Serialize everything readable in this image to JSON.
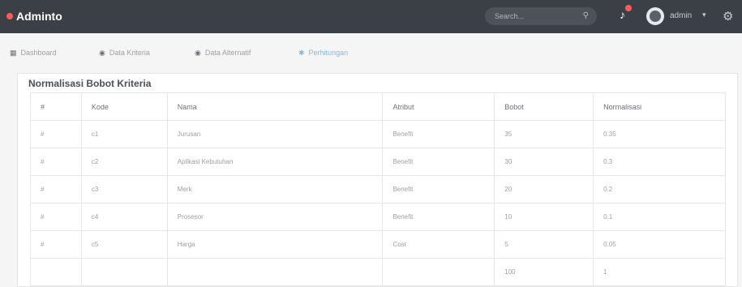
{
  "brand": {
    "name": "Adminto"
  },
  "search": {
    "placeholder": "Search..."
  },
  "user": {
    "name": "admin"
  },
  "nav": [
    {
      "label": "Dashboard"
    },
    {
      "label": "Data Kriteria"
    },
    {
      "label": "Data Alternatif"
    },
    {
      "label": "Perhitungan"
    }
  ],
  "card": {
    "title": "Normalisasi Bobot Kriteria"
  },
  "table": {
    "headers": [
      "#",
      "Kode",
      "Nama",
      "Atribut",
      "Bobot",
      "Normalisasi"
    ],
    "rows": [
      [
        "#",
        "c1",
        "Jurusan",
        "Benefit",
        "35",
        "0.35"
      ],
      [
        "#",
        "c2",
        "Aplikasi Kebutuhan",
        "Benefit",
        "30",
        "0.3"
      ],
      [
        "#",
        "c3",
        "Merk",
        "Benefit",
        "20",
        "0.2"
      ],
      [
        "#",
        "c4",
        "Prosesor",
        "Benefit",
        "10",
        "0.1"
      ],
      [
        "#",
        "c5",
        "Harga",
        "Cost",
        "5",
        "0.05"
      ],
      [
        "",
        "",
        "",
        "",
        "100",
        "1"
      ]
    ]
  },
  "colors": {
    "topbar": "#3b3f46",
    "accent": "#ff5b5b",
    "active_nav": "#7fb9e8"
  }
}
